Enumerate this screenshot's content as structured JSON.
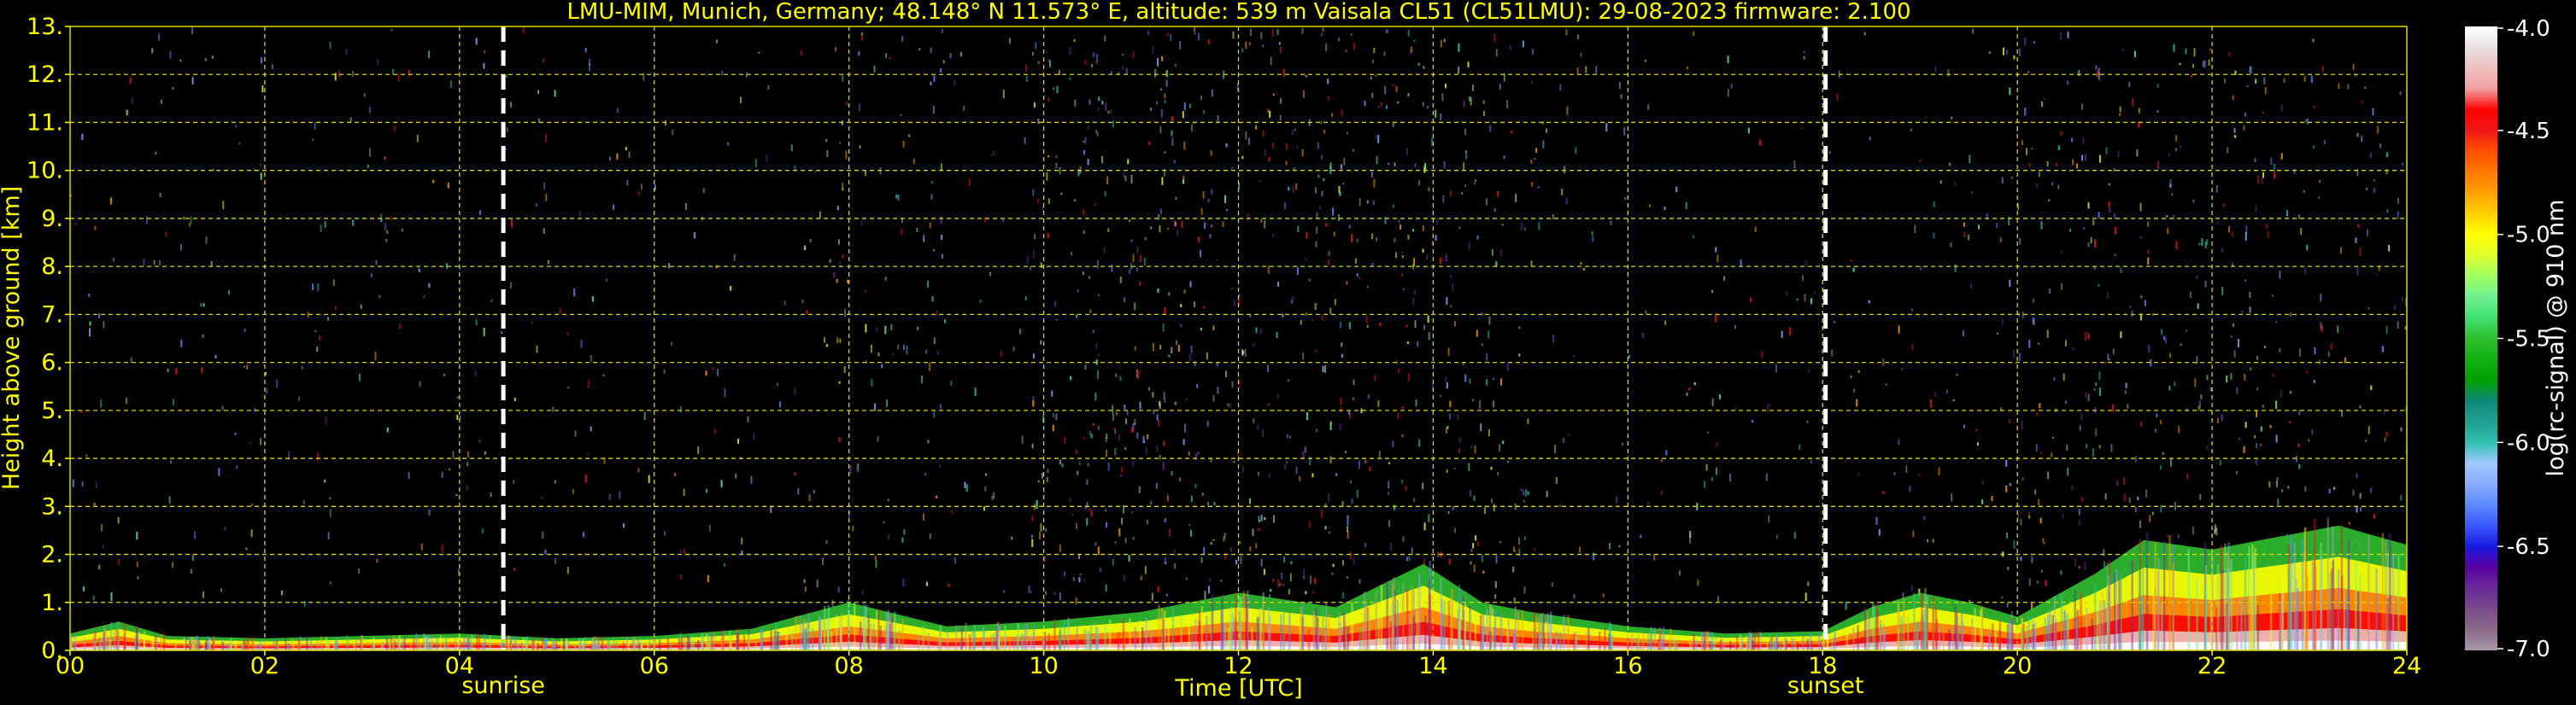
{
  "chart_data": {
    "type": "heatmap",
    "title": "LMU-MIM, Munich, Germany; 48.148° N 11.573° E, altitude: 539 m    Vaisala CL51 (CL51LMU): 29-08-2023    firmware: 2.100",
    "xlabel": "Time [UTC]",
    "ylabel": "Height above ground [km]",
    "x_ticks": [
      "00",
      "02",
      "04",
      "06",
      "08",
      "10",
      "12",
      "14",
      "16",
      "18",
      "20",
      "22",
      "24"
    ],
    "y_ticks": [
      "0.",
      "1.",
      "2.",
      "3.",
      "4.",
      "5.",
      "6.",
      "7.",
      "8.",
      "9.",
      "10.",
      "11.",
      "12.",
      "13."
    ],
    "xlim": [
      0,
      24
    ],
    "ylim": [
      0,
      13
    ],
    "grid": true,
    "colorbar": {
      "label": "log(rc-signal) @ 910 nm",
      "range": [
        -7.0,
        -4.0
      ],
      "ticks": [
        "-4.0",
        "-4.5",
        "-5.0",
        "-5.5",
        "-6.0",
        "-6.5",
        "-7.0"
      ],
      "colors": [
        "#a898a8",
        "#8a6a8a",
        "#7a4a8a",
        "#6a2a9a",
        "#5a00a0",
        "#1a1ae0",
        "#3a5aff",
        "#5a8aff",
        "#8aaaff",
        "#a0c8ff",
        "#30c0b0",
        "#20a090",
        "#108878",
        "#00a000",
        "#10b010",
        "#30c030",
        "#40e070",
        "#70f090",
        "#a0ff60",
        "#e0ff30",
        "#ffff00",
        "#ffd000",
        "#ffa000",
        "#ff7800",
        "#ff5000",
        "#f01818",
        "#ff0000",
        "#f0a0a0",
        "#f0c0c0",
        "#e8e0e0",
        "#ffffff"
      ]
    },
    "markers": [
      {
        "x": 4.45,
        "label": "sunrise"
      },
      {
        "x": 18.03,
        "label": "sunset"
      }
    ],
    "boundary_layer_km": [
      [
        0,
        0.35
      ],
      [
        0.5,
        0.6
      ],
      [
        1,
        0.3
      ],
      [
        2,
        0.25
      ],
      [
        3,
        0.3
      ],
      [
        4,
        0.35
      ],
      [
        5,
        0.25
      ],
      [
        6,
        0.3
      ],
      [
        7,
        0.45
      ],
      [
        8,
        1.0
      ],
      [
        9,
        0.5
      ],
      [
        10,
        0.6
      ],
      [
        11,
        0.8
      ],
      [
        12,
        1.2
      ],
      [
        13,
        0.9
      ],
      [
        13.9,
        1.8
      ],
      [
        14.5,
        1.0
      ],
      [
        15,
        0.8
      ],
      [
        16,
        0.5
      ],
      [
        17,
        0.35
      ],
      [
        18,
        0.4
      ],
      [
        18.5,
        0.9
      ],
      [
        19,
        1.2
      ],
      [
        19.5,
        1.0
      ],
      [
        20,
        0.7
      ],
      [
        20.8,
        1.6
      ],
      [
        21.3,
        2.3
      ],
      [
        22,
        2.1
      ],
      [
        22.5,
        2.3
      ],
      [
        23.3,
        2.6
      ],
      [
        24,
        2.2
      ]
    ],
    "signal_color": "#ffff00",
    "grid_color": "#d8d800",
    "marker_color": "#ffffff",
    "background_color": "#000000"
  }
}
